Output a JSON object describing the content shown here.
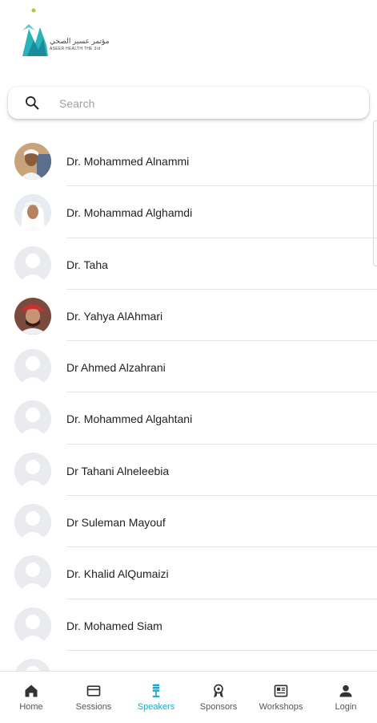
{
  "header": {
    "logo_arabic": "مؤتمر عسير الصحي",
    "logo_english": "ASEER HEALTH THE 3rd"
  },
  "search": {
    "placeholder": "Search",
    "value": ""
  },
  "speakers": [
    {
      "name": "Dr. Mohammed Alnammi",
      "avatar": "photo-1"
    },
    {
      "name": "Dr. Mohammad Alghamdi",
      "avatar": "photo-2"
    },
    {
      "name": "Dr. Taha",
      "avatar": "placeholder"
    },
    {
      "name": "Dr. Yahya AlAhmari",
      "avatar": "photo-3"
    },
    {
      "name": "Dr Ahmed Alzahrani",
      "avatar": "placeholder"
    },
    {
      "name": "Dr. Mohammed Algahtani",
      "avatar": "placeholder"
    },
    {
      "name": "Dr Tahani Alneleebia",
      "avatar": "placeholder"
    },
    {
      "name": "Dr Suleman Mayouf",
      "avatar": "placeholder"
    },
    {
      "name": "Dr. Khalid AlQumaizi",
      "avatar": "placeholder"
    },
    {
      "name": "Dr. Mohamed Siam",
      "avatar": "placeholder"
    },
    {
      "name": "",
      "avatar": "placeholder"
    }
  ],
  "nav": {
    "home": "Home",
    "sessions": "Sessions",
    "speakers": "Speakers",
    "sponsors": "Sponsors",
    "workshops": "Workshops",
    "login": "Login",
    "active": "speakers",
    "active_color": "#1aa6c9",
    "inactive_color": "#555555"
  }
}
